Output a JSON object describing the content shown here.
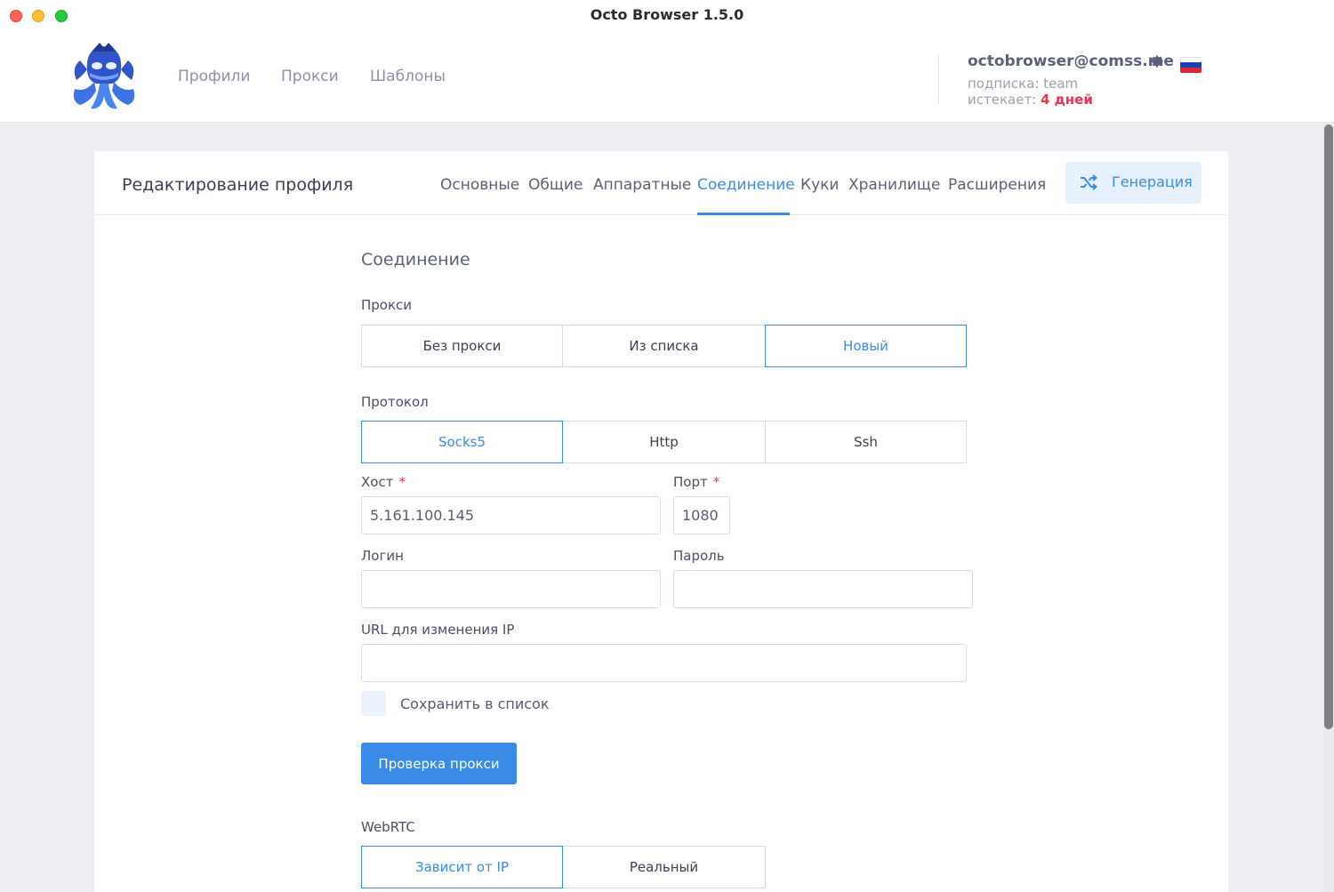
{
  "window": {
    "title": "Octo Browser 1.5.0"
  },
  "nav": {
    "items": [
      "Профили",
      "Прокси",
      "Шаблоны"
    ]
  },
  "account": {
    "email": "octobrowser@comss.me",
    "subscription": "подписка: team",
    "expires_prefix": "истекает:",
    "expires_value": "4 дней",
    "language_flag": "ru-flag-icon"
  },
  "profile_editor": {
    "title": "Редактирование профиля",
    "tabs": [
      "Основные",
      "Общие",
      "Аппаратные",
      "Соединение",
      "Куки",
      "Хранилище",
      "Расширения"
    ],
    "active_tab": "Соединение",
    "generate_button": "Генерация"
  },
  "connection": {
    "section_title": "Соединение",
    "proxy_label": "Прокси",
    "proxy_options": [
      "Без прокси",
      "Из списка",
      "Новый"
    ],
    "proxy_selected": "Новый",
    "protocol_label": "Протокол",
    "protocol_options": [
      "Socks5",
      "Http",
      "Ssh"
    ],
    "protocol_selected": "Socks5",
    "host_label": "Хост",
    "host_value": "5.161.100.145",
    "port_label": "Порт",
    "port_value": "1080",
    "required_mark": "*",
    "login_label": "Логин",
    "login_value": "",
    "password_label": "Пароль",
    "password_value": "",
    "change_ip_url_label": "URL для изменения IP",
    "change_ip_url_value": "",
    "save_to_list_label": "Сохранить в список",
    "save_to_list_checked": false,
    "check_proxy_button": "Проверка прокси",
    "webrtc_label": "WebRTC",
    "webrtc_options": [
      "Зависит от IP",
      "Реальный"
    ],
    "webrtc_selected": "Зависит от IP"
  },
  "colors": {
    "accent": "#3a8be8",
    "danger": "#e8364f",
    "background": "#eceef1"
  }
}
